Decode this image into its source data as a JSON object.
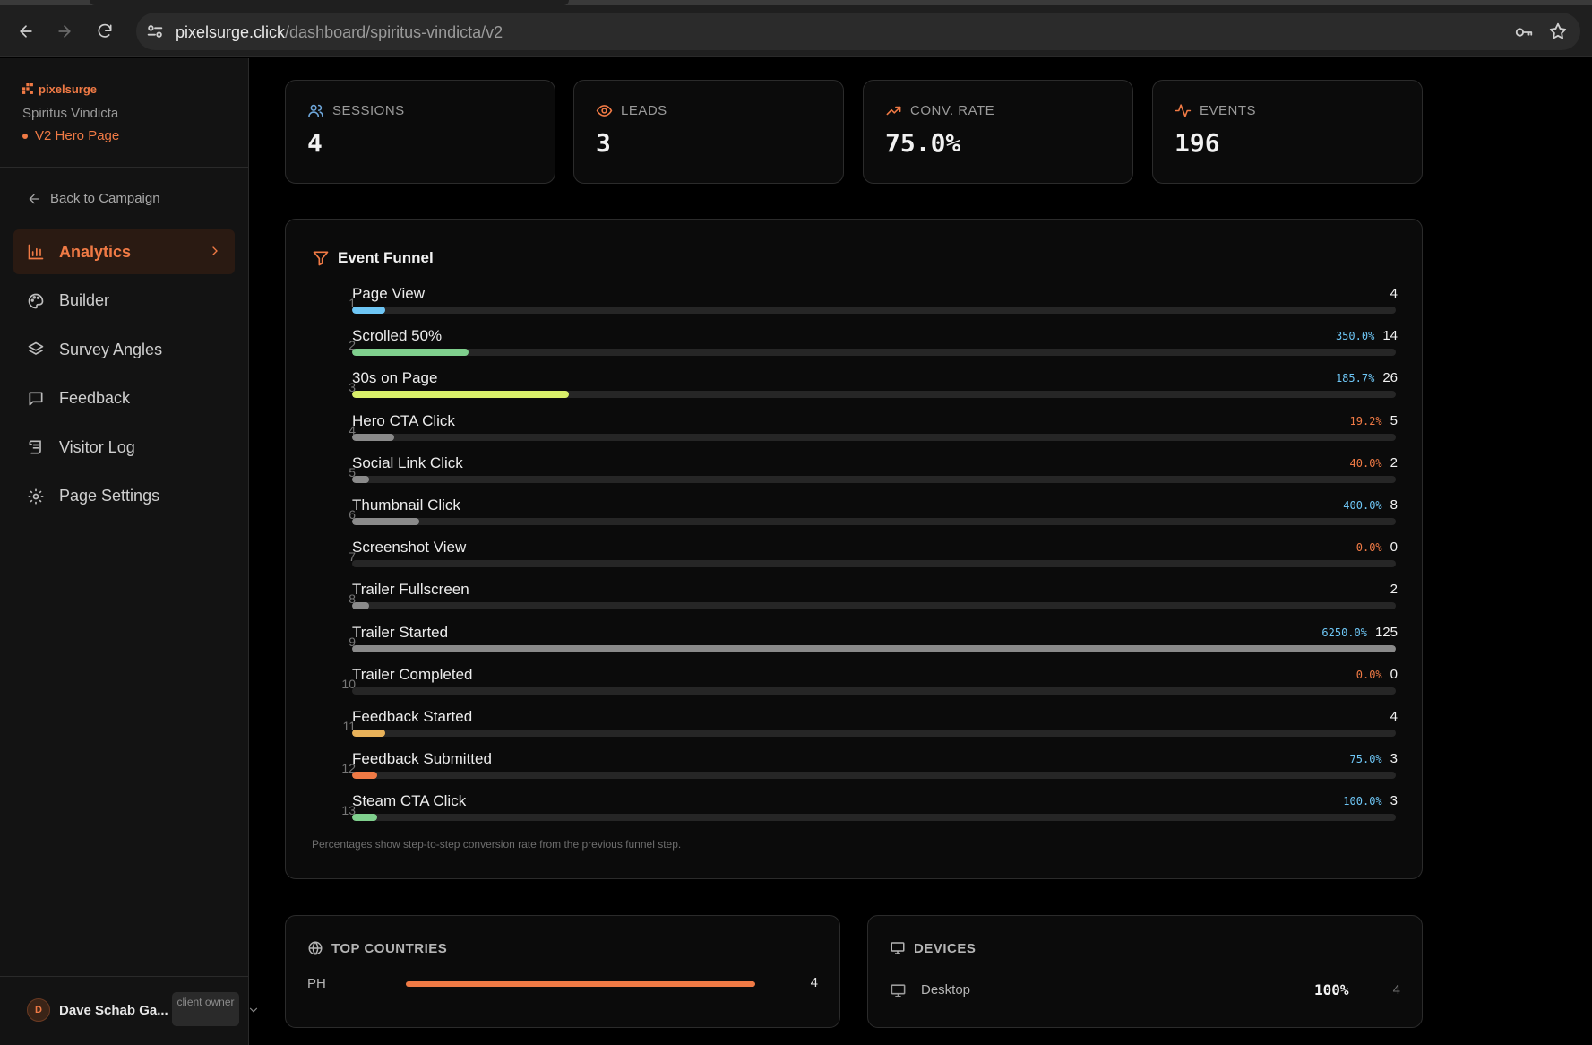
{
  "browser": {
    "url_host": "pixelsurge.click",
    "url_path": "/dashboard/spiritus-vindicta/v2"
  },
  "sidebar": {
    "brand": "pixelsurge",
    "campaign": "Spiritus Vindicta",
    "page": "V2 Hero Page",
    "back_label": "Back to Campaign",
    "items": [
      {
        "label": "Analytics",
        "icon": "bar-chart-icon",
        "active": true
      },
      {
        "label": "Builder",
        "icon": "palette-icon"
      },
      {
        "label": "Survey Angles",
        "icon": "layers-icon"
      },
      {
        "label": "Feedback",
        "icon": "message-square-icon"
      },
      {
        "label": "Visitor Log",
        "icon": "scroll-icon"
      },
      {
        "label": "Page Settings",
        "icon": "gear-icon"
      }
    ],
    "user": {
      "initial": "D",
      "name": "Dave Schab Ga...",
      "role": "client owner"
    }
  },
  "stats": [
    {
      "label": "SESSIONS",
      "value": "4",
      "icon": "users-icon",
      "color": "#6fa8dc"
    },
    {
      "label": "LEADS",
      "value": "3",
      "icon": "eye-icon",
      "color": "#f07a45"
    },
    {
      "label": "CONV. RATE",
      "value": "75.0%",
      "icon": "trending-up-icon",
      "color": "#f07a45"
    },
    {
      "label": "EVENTS",
      "value": "196",
      "icon": "activity-icon",
      "color": "#f07a45"
    }
  ],
  "funnel": {
    "title": "Event Funnel",
    "note": "Percentages show step-to-step conversion rate from the previous funnel step.",
    "max_count": 125,
    "steps": [
      {
        "num": "1",
        "name": "Page View",
        "pct": "",
        "pct_color": "",
        "count": 4,
        "bar_color": "#6ec6f5"
      },
      {
        "num": "2",
        "name": "Scrolled 50%",
        "pct": "350.0%",
        "pct_color": "#6ec6f5",
        "count": 14,
        "bar_color": "#7fcf8d"
      },
      {
        "num": "3",
        "name": "30s on Page",
        "pct": "185.7%",
        "pct_color": "#6ec6f5",
        "count": 26,
        "bar_color": "#d9ef6a"
      },
      {
        "num": "4",
        "name": "Hero CTA Click",
        "pct": "19.2%",
        "pct_color": "#f07a45",
        "count": 5,
        "bar_color": "#8a8a8a"
      },
      {
        "num": "5",
        "name": "Social Link Click",
        "pct": "40.0%",
        "pct_color": "#f07a45",
        "count": 2,
        "bar_color": "#8a8a8a"
      },
      {
        "num": "6",
        "name": "Thumbnail Click",
        "pct": "400.0%",
        "pct_color": "#6ec6f5",
        "count": 8,
        "bar_color": "#8a8a8a"
      },
      {
        "num": "7",
        "name": "Screenshot View",
        "pct": "0.0%",
        "pct_color": "#f07a45",
        "count": 0,
        "bar_color": "#8a8a8a"
      },
      {
        "num": "8",
        "name": "Trailer Fullscreen",
        "pct": "",
        "pct_color": "",
        "count": 2,
        "bar_color": "#8a8a8a"
      },
      {
        "num": "9",
        "name": "Trailer Started",
        "pct": "6250.0%",
        "pct_color": "#6ec6f5",
        "count": 125,
        "bar_color": "#8a8a8a"
      },
      {
        "num": "10",
        "name": "Trailer Completed",
        "pct": "0.0%",
        "pct_color": "#f07a45",
        "count": 0,
        "bar_color": "#8a8a8a"
      },
      {
        "num": "11",
        "name": "Feedback Started",
        "pct": "",
        "pct_color": "",
        "count": 4,
        "bar_color": "#e8b25a"
      },
      {
        "num": "12",
        "name": "Feedback Submitted",
        "pct": "75.0%",
        "pct_color": "#6ec6f5",
        "count": 3,
        "bar_color": "#f07a45"
      },
      {
        "num": "13",
        "name": "Steam CTA Click",
        "pct": "100.0%",
        "pct_color": "#6ec6f5",
        "count": 3,
        "bar_color": "#7fcf8d"
      }
    ]
  },
  "countries": {
    "title": "TOP COUNTRIES",
    "rows": [
      {
        "code": "PH",
        "count": "4",
        "share": 1.0
      }
    ]
  },
  "devices": {
    "title": "DEVICES",
    "rows": [
      {
        "name": "Desktop",
        "pct": "100%",
        "count": "4"
      }
    ]
  }
}
